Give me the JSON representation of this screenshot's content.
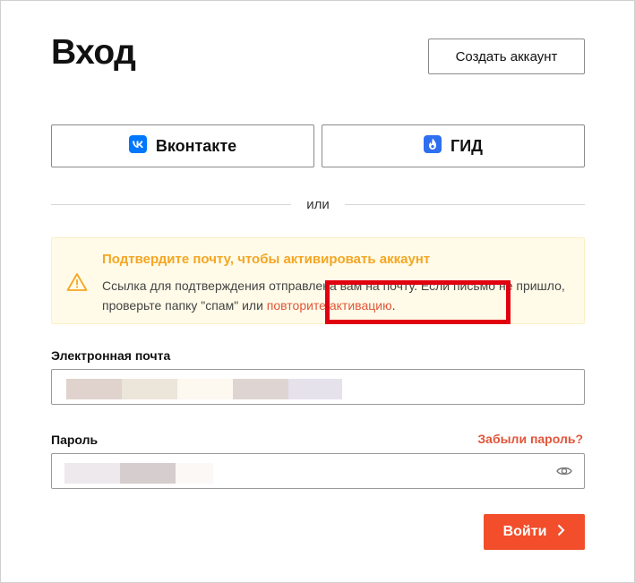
{
  "page": {
    "title": "Вход"
  },
  "header": {
    "create_account_label": "Создать аккаунт"
  },
  "social": {
    "vk_label": "Вконтакте",
    "gid_label": "ГИД"
  },
  "divider": {
    "text": "или"
  },
  "alert": {
    "title": "Подтвердите почту, чтобы активировать аккаунт",
    "text_before": "Ссылка для подтверждения отправлена вам на почту. Если письмо не пришло, проверьте папку \"спам\" или ",
    "link": "повторите активацию",
    "text_after": "."
  },
  "form": {
    "email_label": "Электронная почта",
    "email_value": "",
    "password_label": "Пароль",
    "password_value": "",
    "forgot_label": "Забыли пароль?",
    "submit_label": "Войти"
  },
  "icons": {
    "vk": "vk-logo-icon",
    "gid": "gid-logo-icon",
    "warning": "warning-triangle-icon",
    "eye": "eye-icon",
    "chevron": "chevron-right-icon"
  },
  "colors": {
    "accent": "#f24e2b",
    "link": "#e0563a",
    "alert_title": "#f4a623",
    "alert_bg": "#fffbe8",
    "highlight": "#e0000f",
    "vk": "#0077ff",
    "gid": "#2e6ff0"
  }
}
